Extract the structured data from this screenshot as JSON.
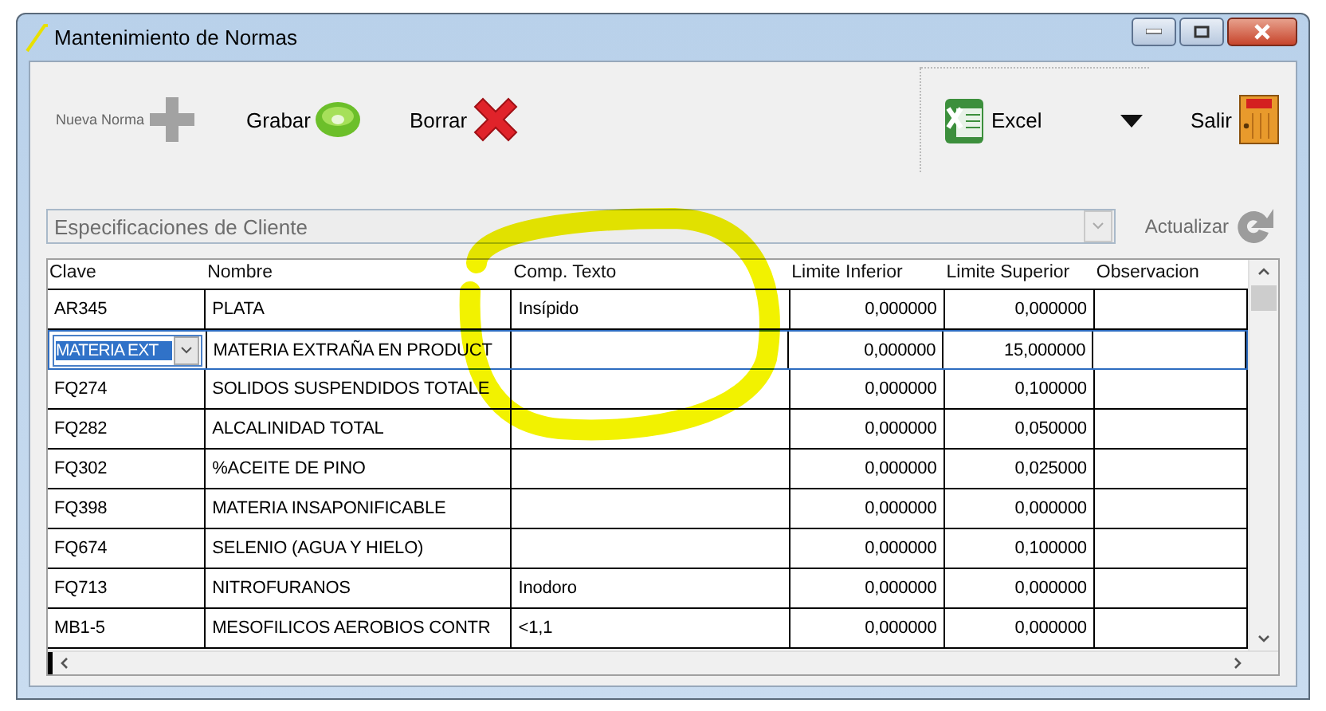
{
  "window": {
    "title": "Mantenimiento de Normas"
  },
  "toolbar": [
    {
      "kind": "new",
      "label": "Nueva Norma",
      "disabled": true
    },
    {
      "kind": "save",
      "label": "Grabar",
      "disabled": false
    },
    {
      "kind": "delete",
      "label": "Borrar",
      "disabled": false
    },
    {
      "kind": "export",
      "label": "Excel",
      "disabled": false
    },
    {
      "kind": "exit",
      "label": "Salir",
      "disabled": false
    }
  ],
  "filter": {
    "value": "Especificaciones de Cliente",
    "disabled": true
  },
  "refresh": {
    "label": "Actualizar",
    "disabled": true
  },
  "table": {
    "columns": [
      {
        "label": "Clave",
        "kind": "text"
      },
      {
        "label": "Nombre",
        "kind": "text"
      },
      {
        "label": "Comp. Texto",
        "kind": "text"
      },
      {
        "label": "Limite Inferior",
        "kind": "numeric"
      },
      {
        "label": "Limite Superior",
        "kind": "numeric"
      },
      {
        "label": "Observacion",
        "kind": "text"
      }
    ],
    "rows": [
      {
        "selected": false,
        "clave": "AR345",
        "nombre": "PLATA",
        "comp_texto": "Insípido",
        "limite_inferior": "0,000000",
        "limite_superior": "0,000000"
      },
      {
        "selected": true,
        "clave": "MATERIA EXT",
        "nombre": "MATERIA EXTRAÑA EN PRODUCT",
        "limite_inferior": "0,000000",
        "limite_superior": "15,000000"
      },
      {
        "selected": false,
        "clave": "FQ274",
        "nombre": "SOLIDOS SUSPENDIDOS TOTALE",
        "limite_inferior": "0,000000",
        "limite_superior": "0,100000"
      },
      {
        "selected": false,
        "clave": "FQ282",
        "nombre": "ALCALINIDAD TOTAL",
        "limite_inferior": "0,000000",
        "limite_superior": "0,050000"
      },
      {
        "selected": false,
        "clave": "FQ302",
        "nombre": "%ACEITE DE PINO",
        "limite_inferior": "0,000000",
        "limite_superior": "0,025000"
      },
      {
        "selected": false,
        "clave": "FQ398",
        "nombre": "MATERIA INSAPONIFICABLE",
        "limite_inferior": "0,000000",
        "limite_superior": "0,000000"
      },
      {
        "selected": false,
        "clave": "FQ674",
        "nombre": "SELENIO (AGUA Y HIELO)",
        "limite_inferior": "0,000000",
        "limite_superior": "0,100000"
      },
      {
        "selected": false,
        "clave": "FQ713",
        "nombre": "NITROFURANOS",
        "comp_texto": "Inodoro",
        "limite_inferior": "0,000000",
        "limite_superior": "0,000000"
      },
      {
        "selected": false,
        "clave": "MB1-5",
        "nombre": "MESOFILICOS AEROBIOS CONTR",
        "comp_texto": "<1,1",
        "limite_inferior": "0,000000",
        "limite_superior": "0,000000"
      }
    ]
  }
}
